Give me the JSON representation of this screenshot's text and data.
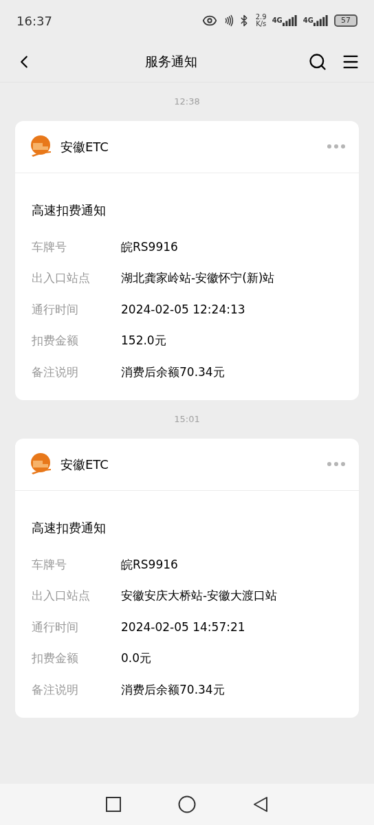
{
  "status_bar": {
    "time": "16:37",
    "speed_value": "2.9",
    "speed_unit": "K/s",
    "networks": [
      "4G",
      "4G"
    ],
    "battery": "57"
  },
  "nav": {
    "title": "服务通知"
  },
  "messages": [
    {
      "time": "12:38",
      "sender": "安徽ETC",
      "title": "高速扣费通知",
      "fields": [
        {
          "label": "车牌号",
          "value": "皖RS9916"
        },
        {
          "label": "出入口站点",
          "value": "湖北龚家岭站-安徽怀宁(新)站"
        },
        {
          "label": "通行时间",
          "value": "2024-02-05 12:24:13"
        },
        {
          "label": "扣费金额",
          "value": "152.0元"
        },
        {
          "label": "备注说明",
          "value": "消费后余额70.34元"
        }
      ]
    },
    {
      "time": "15:01",
      "sender": "安徽ETC",
      "title": "高速扣费通知",
      "fields": [
        {
          "label": "车牌号",
          "value": "皖RS9916"
        },
        {
          "label": "出入口站点",
          "value": "安徽安庆大桥站-安徽大渡口站"
        },
        {
          "label": "通行时间",
          "value": "2024-02-05 14:57:21"
        },
        {
          "label": "扣费金额",
          "value": "0.0元"
        },
        {
          "label": "备注说明",
          "value": "消费后余额70.34元"
        }
      ]
    }
  ]
}
